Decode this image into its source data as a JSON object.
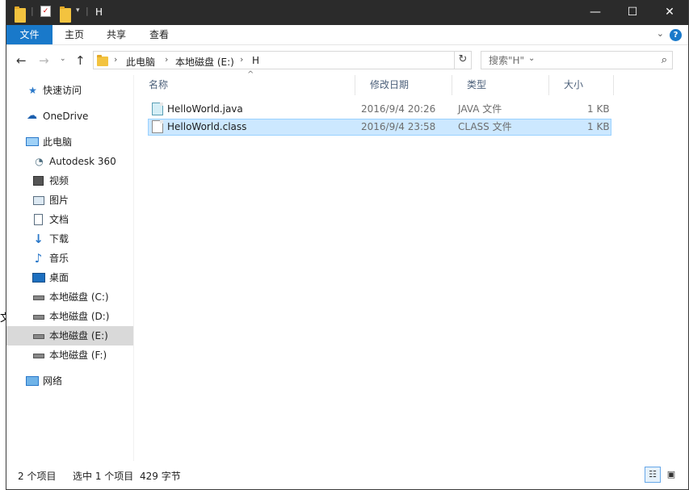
{
  "window": {
    "title": "H",
    "controls": {
      "minimize": "—",
      "maximize": "☐",
      "close": "✕"
    }
  },
  "ribbon": {
    "tabs": [
      "文件",
      "主页",
      "共享",
      "查看"
    ],
    "help": "?"
  },
  "address": {
    "crumbs": [
      "此电脑",
      "本地磁盘 (E:)",
      "H"
    ],
    "search_placeholder": "搜索\"H\""
  },
  "nav": {
    "items": [
      {
        "label": "快速访问",
        "icon": "star-icon"
      },
      {
        "label": "OneDrive",
        "icon": "cloud-icon"
      },
      {
        "label": "此电脑",
        "icon": "computer-icon"
      },
      {
        "label": "Autodesk 360",
        "icon": "autodesk-icon"
      },
      {
        "label": "视频",
        "icon": "video-icon"
      },
      {
        "label": "图片",
        "icon": "pictures-icon"
      },
      {
        "label": "文档",
        "icon": "documents-icon"
      },
      {
        "label": "下载",
        "icon": "download-icon"
      },
      {
        "label": "音乐",
        "icon": "music-icon"
      },
      {
        "label": "桌面",
        "icon": "desktop-icon"
      },
      {
        "label": "本地磁盘 (C:)",
        "icon": "drive-icon"
      },
      {
        "label": "本地磁盘 (D:)",
        "icon": "drive-icon"
      },
      {
        "label": "本地磁盘 (E:)",
        "icon": "drive-icon",
        "selected": true
      },
      {
        "label": "本地磁盘 (F:)",
        "icon": "drive-icon"
      },
      {
        "label": "网络",
        "icon": "network-icon"
      }
    ]
  },
  "columns": [
    "名称",
    "修改日期",
    "类型",
    "大小"
  ],
  "files": [
    {
      "name": "HelloWorld.java",
      "modified": "2016/9/4 20:26",
      "type": "JAVA 文件",
      "size": "1 KB"
    },
    {
      "name": "HelloWorld.class",
      "modified": "2016/9/4 23:58",
      "type": "CLASS 文件",
      "size": "1 KB",
      "selected": true
    }
  ],
  "status": {
    "item_count": "2 个项目",
    "selection": "选中 1 个项目",
    "selection_size": "429 字节"
  },
  "background_text": "文"
}
